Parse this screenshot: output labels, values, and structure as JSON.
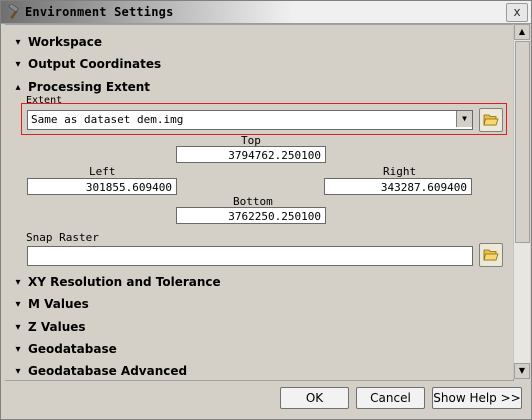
{
  "window": {
    "title": "Environment Settings",
    "close_glyph": "x"
  },
  "sections": {
    "workspace": "Workspace",
    "output_coordinates": "Output Coordinates",
    "processing_extent": "Processing Extent",
    "xy_resolution": "XY Resolution and Tolerance",
    "m_values": "M Values",
    "z_values": "Z Values",
    "geodatabase": "Geodatabase",
    "geodatabase_advanced": "Geodatabase Advanced"
  },
  "extent": {
    "label": "Extent",
    "selected": "Same as dataset dem.img"
  },
  "coords": {
    "top_label": "Top",
    "top_value": "3794762.250100",
    "left_label": "Left",
    "left_value": "301855.609400",
    "right_label": "Right",
    "right_value": "343287.609400",
    "bottom_label": "Bottom",
    "bottom_value": "3762250.250100"
  },
  "snap_raster": {
    "label": "Snap Raster",
    "value": ""
  },
  "buttons": {
    "ok": "OK",
    "cancel": "Cancel",
    "show_help": "Show Help >>"
  },
  "colors": {
    "dialog_bg": "#d4d0c8",
    "highlight_border": "#e02020"
  },
  "icons": {
    "collapsed": "double-chevron-down-icon",
    "expanded": "double-chevron-up-icon",
    "folder": "folder-open-icon"
  }
}
